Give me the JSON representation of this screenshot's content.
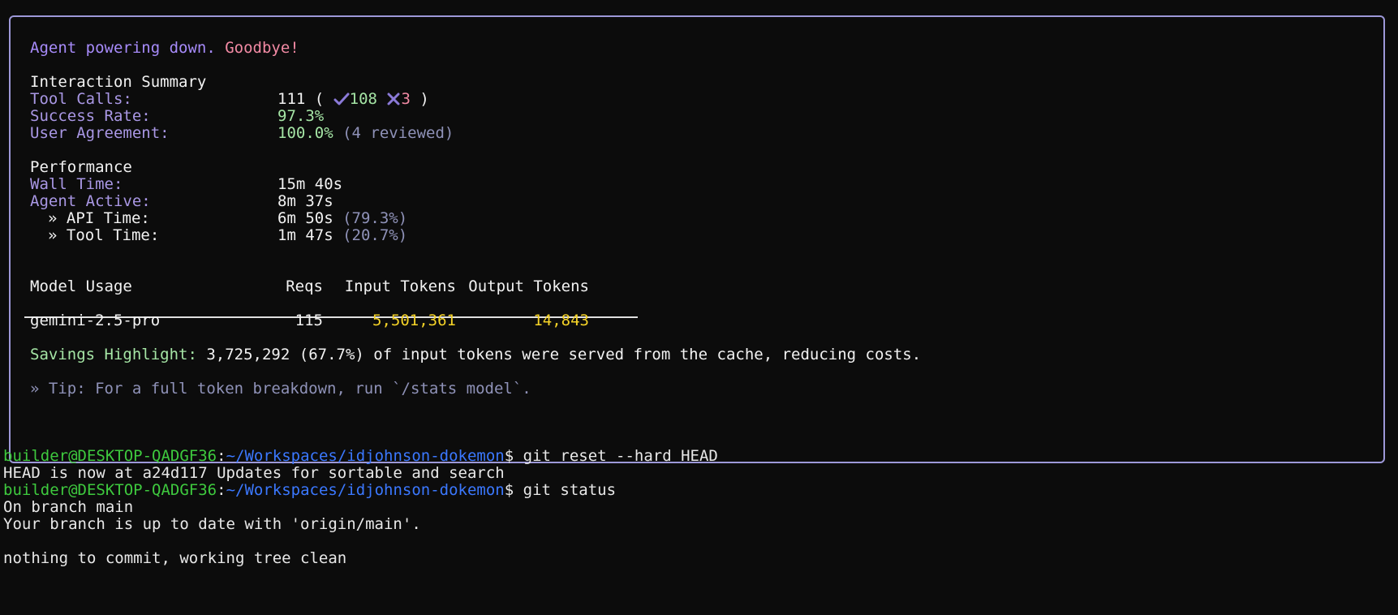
{
  "summary": {
    "farewell_agent": "Agent powering down.",
    "farewell_bye": "Goodbye!",
    "interaction": {
      "heading": "Interaction Summary",
      "tool_calls_label": "Tool Calls:",
      "tool_calls_total": "111 (",
      "tool_calls_success": "108",
      "tool_calls_fail": "3",
      "tool_calls_close": ")",
      "success_rate_label": "Success Rate:",
      "success_rate_value": "97.3%",
      "user_agreement_label": "User Agreement:",
      "user_agreement_value": "100.0%",
      "user_agreement_note": "(4 reviewed)"
    },
    "performance": {
      "heading": "Performance",
      "wall_time_label": "Wall Time:",
      "wall_time_value": "15m 40s",
      "agent_active_label": "Agent Active:",
      "agent_active_value": "8m 37s",
      "api_time_label": "» API Time:",
      "api_time_value": "6m 50s",
      "api_time_pct": "(79.3%)",
      "tool_time_label": "» Tool Time:",
      "tool_time_value": "1m 47s",
      "tool_time_pct": "(20.7%)"
    },
    "model_usage": {
      "headers": [
        "Model Usage",
        "Reqs",
        "Input Tokens",
        "Output Tokens"
      ],
      "rows": [
        {
          "model": "gemini-2.5-pro",
          "reqs": "115",
          "input": "5,501,361",
          "output": "14,843"
        }
      ]
    },
    "savings_label": "Savings Highlight:",
    "savings_text": "3,725,292 (67.7%) of input tokens were served from the cache, reducing costs.",
    "tip": "» Tip: For a full token breakdown, run `/stats model`."
  },
  "terminal": {
    "prompt_user": "builder@DESKTOP-QADGF36",
    "prompt_sep": ":",
    "prompt_path": "~/Workspaces/idjohnson-dokemon",
    "prompt_char": "$",
    "cmd1": "git reset --hard HEAD",
    "out1": "HEAD is now at a24d117 Updates for sortable and search",
    "cmd2": "git status",
    "out2": "On branch main",
    "out3": "Your branch is up to date with 'origin/main'.",
    "out4": "nothing to commit, working tree clean"
  },
  "colors": {
    "background": "#0c0c0c",
    "border": "#9d98d8",
    "label": "#a997e4",
    "green": "#a5e5a5",
    "yellow": "#f5d327",
    "prompt_user": "#3ec93e",
    "prompt_path": "#3b78ff"
  }
}
